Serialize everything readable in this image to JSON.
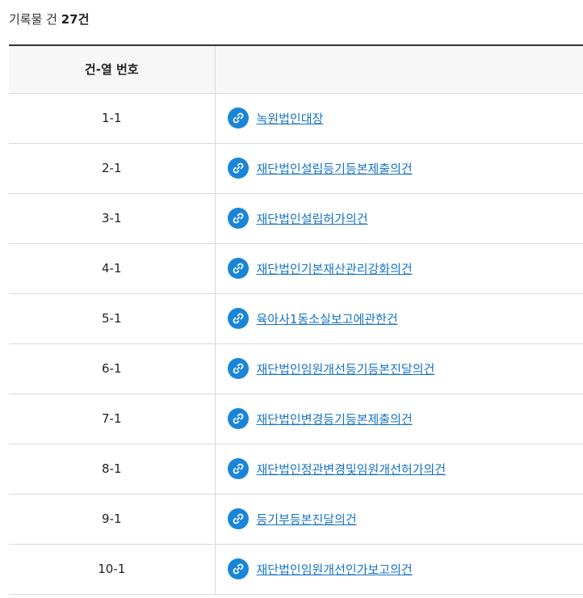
{
  "header": {
    "count_prefix": "기록물 건",
    "count_value": "27건"
  },
  "table": {
    "columns": {
      "number": "건-열 번호",
      "title": ""
    },
    "link_icon": "link-icon",
    "accent_color": "#1a85d8",
    "link_color": "#1573c4",
    "rows": [
      {
        "number": "1-1",
        "title": "녹원법인대장"
      },
      {
        "number": "2-1",
        "title": "재단법인설립등기등본제출의건"
      },
      {
        "number": "3-1",
        "title": "재단법인설립허가의건"
      },
      {
        "number": "4-1",
        "title": "재단법인기본재산관리강화의건"
      },
      {
        "number": "5-1",
        "title": "육아사1동소실보고에관한건"
      },
      {
        "number": "6-1",
        "title": "재단법인임원개선등기등본진달의건"
      },
      {
        "number": "7-1",
        "title": "재단법인변경등기등본제출의건"
      },
      {
        "number": "8-1",
        "title": "재단법인정관변경및임원개선허가의건"
      },
      {
        "number": "9-1",
        "title": "등기부등본진달의건"
      },
      {
        "number": "10-1",
        "title": "재단법인임원개선인가보고의건"
      }
    ]
  }
}
